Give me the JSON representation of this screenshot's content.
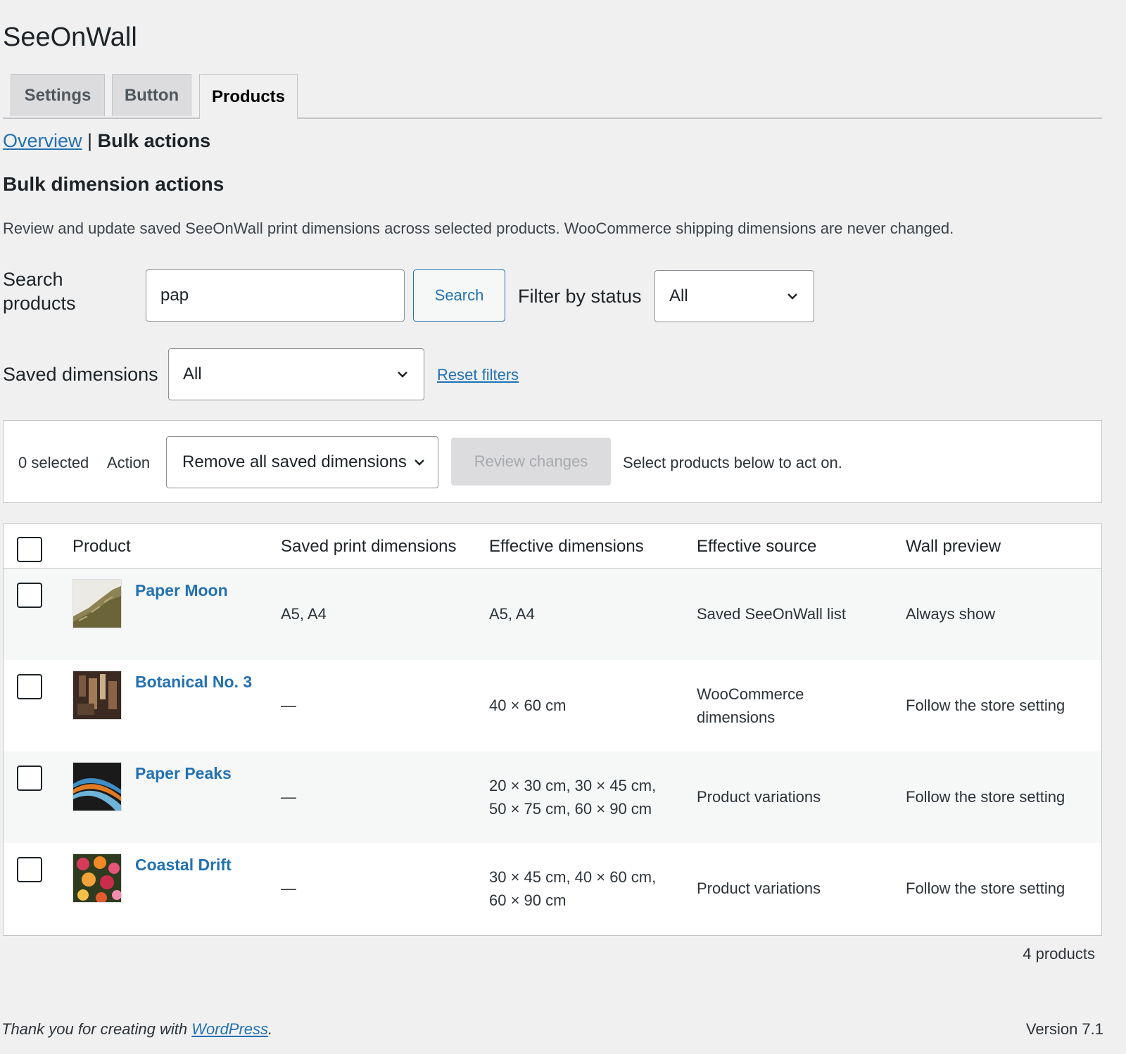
{
  "page": {
    "title": "SeeOnWall"
  },
  "tabs": [
    {
      "label": "Settings"
    },
    {
      "label": "Button"
    },
    {
      "label": "Products"
    }
  ],
  "subnav": {
    "overview": "Overview",
    "separator": "|",
    "current": "Bulk actions"
  },
  "section": {
    "title": "Bulk dimension actions",
    "description": "Review and update saved SeeOnWall print dimensions across selected products. WooCommerce shipping dimensions are never changed."
  },
  "filters": {
    "search_label_line1": "Search",
    "search_label_line2": "products",
    "search_value": "pap",
    "search_button": "Search",
    "status_label": "Filter by status",
    "status_value": "All",
    "saved_label": "Saved dimensions",
    "saved_value": "All",
    "reset": "Reset filters"
  },
  "actionbar": {
    "selected": "0 selected",
    "action_label": "Action",
    "action_value": "Remove all saved dimensions",
    "review_button": "Review changes",
    "hint": "Select products below to act on."
  },
  "table": {
    "headers": [
      "Product",
      "Saved print dimensions",
      "Effective dimensions",
      "Effective source",
      "Wall preview"
    ],
    "rows": [
      {
        "name": "Paper Moon",
        "saved": "A5, A4",
        "effective_line1": "A5, A4",
        "effective_line2": "",
        "source_line1": "Saved SeeOnWall list",
        "source_line2": "",
        "preview": "Always show"
      },
      {
        "name": "Botanical No. 3",
        "saved": "—",
        "effective_line1": "40 × 60 cm",
        "effective_line2": "",
        "source_line1": "WooCommerce",
        "source_line2": "dimensions",
        "preview": "Follow the store setting"
      },
      {
        "name": "Paper Peaks",
        "saved": "—",
        "effective_line1": "20 × 30 cm, 30 × 45 cm,",
        "effective_line2": "50 × 75 cm, 60 × 90 cm",
        "source_line1": "Product variations",
        "source_line2": "",
        "preview": "Follow the store setting"
      },
      {
        "name": "Coastal Drift",
        "saved": "—",
        "effective_line1": "30 × 45 cm, 40 × 60 cm,",
        "effective_line2": "60 × 90 cm",
        "source_line1": "Product variations",
        "source_line2": "",
        "preview": "Follow the store setting"
      }
    ],
    "count": "4 products"
  },
  "footer": {
    "thanks_prefix": "Thank you for creating with ",
    "thanks_link": "WordPress",
    "thanks_suffix": ".",
    "version": "Version 7.1"
  },
  "colors": {
    "accent": "#2271b1",
    "background": "#f0f0f1",
    "text": "#1d2327"
  }
}
